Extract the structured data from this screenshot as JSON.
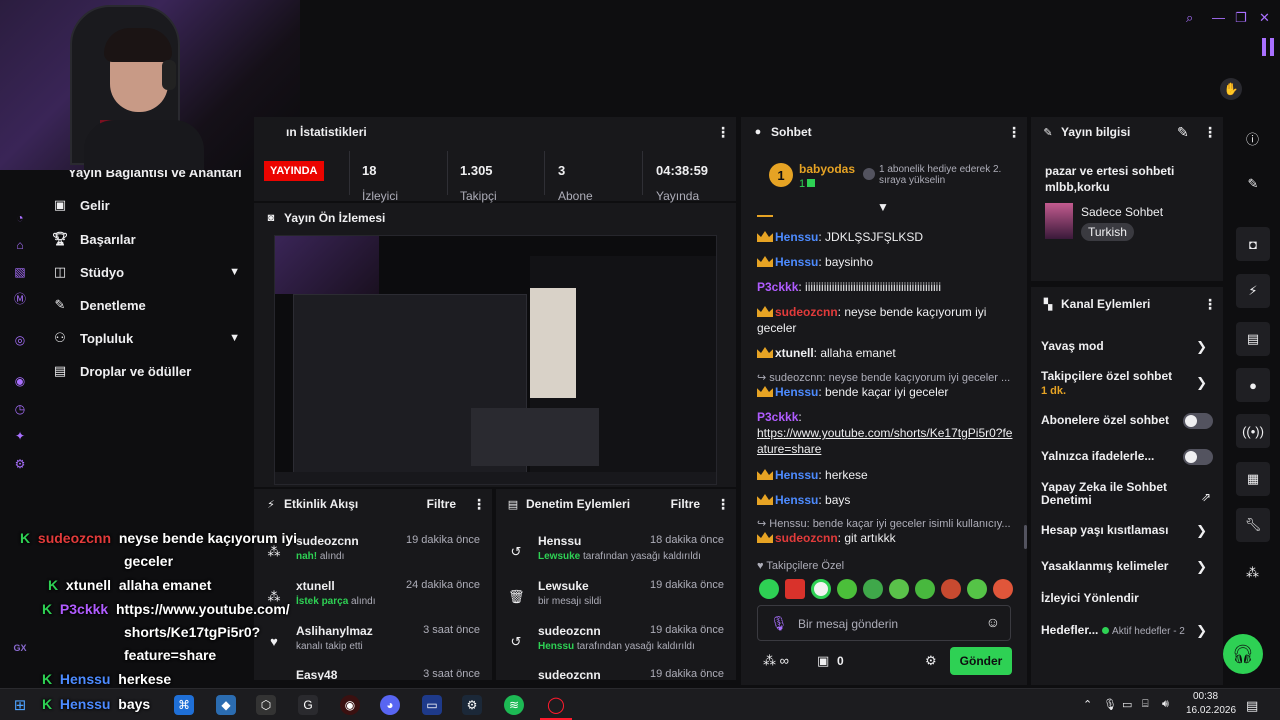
{
  "colors": {
    "accent": "#a970ff",
    "live": "#eb0400",
    "green": "#2ed154",
    "bg": "#0e0e10",
    "panel": "#18181b"
  },
  "left_nav": {
    "section_title": "Yayın Bağlantısı ve Anahtarı",
    "items": [
      {
        "label": "Gelir",
        "icon": "money-icon"
      },
      {
        "label": "Başarılar",
        "icon": "trophy-icon"
      },
      {
        "label": "Stüdyo",
        "icon": "studio-icon"
      },
      {
        "label": "Denetleme",
        "icon": "wrench-icon"
      },
      {
        "label": "Topluluk",
        "icon": "community-icon"
      },
      {
        "label": "Droplar ve ödüller",
        "icon": "drops-icon"
      }
    ],
    "rail_label": "GX"
  },
  "stats": {
    "title": "ın İstatistikleri",
    "live_badge": "YAYINDA",
    "items": [
      {
        "value": "18",
        "label": "İzleyici"
      },
      {
        "value": "1.305",
        "label": "Takipçi"
      },
      {
        "value": "3",
        "label": "Abone"
      },
      {
        "value": "04:38:59",
        "label": "Yayında"
      }
    ]
  },
  "preview": {
    "title": "Yayın Ön İzlemesi"
  },
  "activity": {
    "title": "Etkinlik Akışı",
    "filter": "Filtre",
    "items": [
      {
        "name": "sudeozcnn",
        "time": "19 dakika önce",
        "hl": "nah!",
        "sub": " alındı"
      },
      {
        "name": "xtunell",
        "time": "24 dakika önce",
        "hl": "İstek parça",
        "sub": " alındı"
      },
      {
        "name": "Aslihanylmaz",
        "time": "3 saat önce",
        "hl": "",
        "sub": "kanalı takip etti"
      },
      {
        "name": "Easy48",
        "time": "3 saat önce",
        "hl": "",
        "sub": ""
      }
    ]
  },
  "mod_actions": {
    "title": "Denetim Eylemleri",
    "filter": "Filtre",
    "items": [
      {
        "name": "Henssu",
        "time": "18 dakika önce",
        "hl": "Lewsuke",
        "sub": " tarafından yasağı kaldırıldı"
      },
      {
        "name": "Lewsuke",
        "time": "19 dakika önce",
        "hl": "",
        "sub": "bir mesajı sildi"
      },
      {
        "name": "sudeozcnn",
        "time": "19 dakika önce",
        "hl": "Henssu",
        "sub": " tarafından yasağı kaldırıldı"
      },
      {
        "name": "sudeozcnn",
        "time": "19 dakika önce",
        "hl": "",
        "sub": ""
      }
    ]
  },
  "chat": {
    "title": "Sohbet",
    "leader_name": "babyodas",
    "leader_rank": "1",
    "leader_count": "1",
    "leader_text": "1 abonelik hediye ederek 2. sıraya yükselin",
    "messages": [
      {
        "user": "Henssu",
        "text": ": JDKLŞSJFŞLKSD"
      },
      {
        "user": "Henssu",
        "text": ": baysinho"
      },
      {
        "user": "P3ckkk",
        "text": ": iiiiiiiiiiiiiiiiiiiiiiiiiiiiiiiiiiiiiiiiiiiiiiiiiii"
      },
      {
        "user": "sudeozcnn",
        "text": ": neyse bende kaçıyorum iyi geceler"
      },
      {
        "user": "xtunell",
        "text": ": allaha emanet"
      },
      {
        "user": "Henssu",
        "text": ": bende kaçar iyi geceler",
        "reply": "sudeozcnn: neyse bende kaçıyorum iyi geceler ..."
      },
      {
        "user": "P3ckkk",
        "text": ":",
        "link": "https://www.youtube.com/shorts/Ke17tgPi5r0?feature=share"
      },
      {
        "user": "Henssu",
        "text": ": herkese"
      },
      {
        "user": "Henssu",
        "text": ": bays"
      },
      {
        "user": "sudeozcnn",
        "text": ": git artıkkk",
        "reply": "Henssu: bende kaçar iyi geceler isimli kullanıcıy..."
      }
    ],
    "followers_only": "Takipçilere Özel",
    "input_placeholder": "Bir mesaj gönderin",
    "points": "0",
    "send": "Gönder"
  },
  "info": {
    "title": "Yayın bilgisi",
    "stream_title": "pazar ve ertesi sohbeti mlbb,korku",
    "category": "Sadece Sohbet",
    "tag": "Turkish"
  },
  "channel_actions": {
    "title": "Kanal Eylemleri",
    "items": [
      {
        "label": "Yavaş mod",
        "kind": "chevron"
      },
      {
        "label": "Takipçilere özel sohbet",
        "sub": "1 dk.",
        "kind": "chevron"
      },
      {
        "label": "Abonelere özel sohbet",
        "kind": "toggle"
      },
      {
        "label": "Yalnızca ifadelerle...",
        "kind": "toggle"
      },
      {
        "label": "Yapay Zeka ile Sohbet Denetimi",
        "kind": "external"
      },
      {
        "label": "Hesap yaşı kısıtlaması",
        "kind": "chevron"
      },
      {
        "label": "Yasaklanmış kelimeler",
        "kind": "chevron"
      },
      {
        "label": "İzleyici Yönlendir",
        "kind": "none"
      },
      {
        "label": "Hedefler...",
        "sub": "Aktif hedefler - 2",
        "kind": "chevron"
      }
    ]
  },
  "overlay_chat": [
    {
      "user": "sudeozcnn",
      "text": "neyse bende kaçıyorum iyi"
    },
    {
      "user": "",
      "text": "geceler"
    },
    {
      "user": "xtunell",
      "text": "allaha emanet"
    },
    {
      "user": "P3ckkk",
      "text": "https://www.youtube.com/"
    },
    {
      "user": "",
      "text": "shorts/Ke17tgPi5r0?"
    },
    {
      "user": "",
      "text": "feature=share"
    },
    {
      "user": "Henssu",
      "text": "herkese"
    },
    {
      "user": "Henssu",
      "text": "bays"
    }
  ],
  "taskbar": {
    "time": "00:38",
    "date": "16.02.2026"
  }
}
